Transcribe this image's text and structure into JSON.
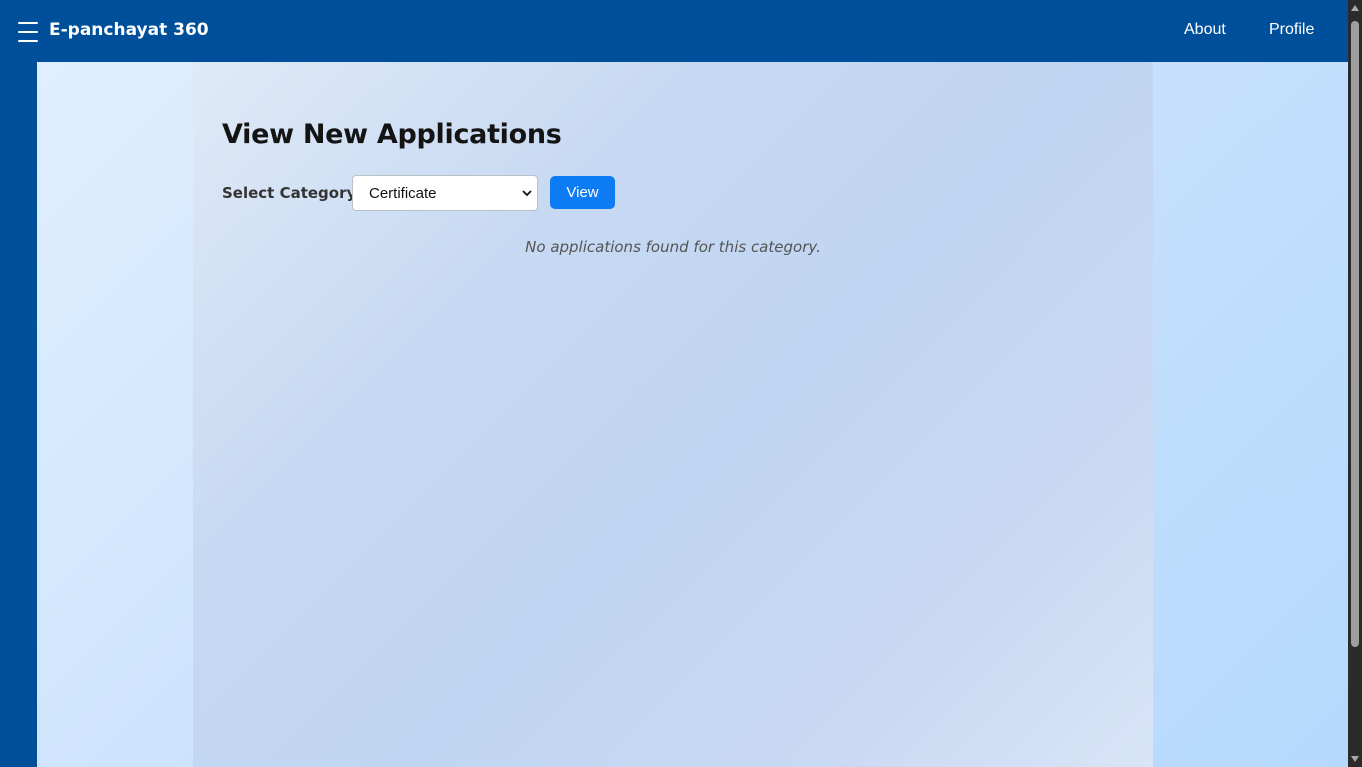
{
  "navbar": {
    "brand": "E-panchayat 360",
    "links": [
      "About",
      "Profile"
    ]
  },
  "main": {
    "title": "View New Applications",
    "category_label": "Select Category:",
    "category_selected": "Certificate",
    "view_button": "View",
    "empty_message": "No applications found for this category."
  },
  "colors": {
    "navbar": "#004f9a",
    "button": "#0d7bf3",
    "page_background": "#c9e1fc"
  },
  "icons": {
    "menu": "hamburger-menu-icon",
    "select": "chevron-down-icon"
  }
}
